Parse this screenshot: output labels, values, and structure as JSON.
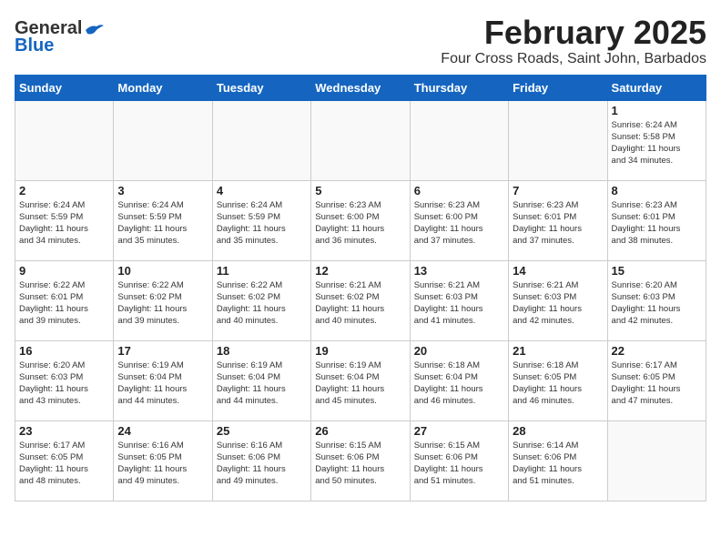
{
  "logo": {
    "general": "General",
    "blue": "Blue"
  },
  "title": "February 2025",
  "subtitle": "Four Cross Roads, Saint John, Barbados",
  "weekdays": [
    "Sunday",
    "Monday",
    "Tuesday",
    "Wednesday",
    "Thursday",
    "Friday",
    "Saturday"
  ],
  "weeks": [
    [
      {
        "day": "",
        "info": ""
      },
      {
        "day": "",
        "info": ""
      },
      {
        "day": "",
        "info": ""
      },
      {
        "day": "",
        "info": ""
      },
      {
        "day": "",
        "info": ""
      },
      {
        "day": "",
        "info": ""
      },
      {
        "day": "1",
        "info": "Sunrise: 6:24 AM\nSunset: 5:58 PM\nDaylight: 11 hours\nand 34 minutes."
      }
    ],
    [
      {
        "day": "2",
        "info": "Sunrise: 6:24 AM\nSunset: 5:59 PM\nDaylight: 11 hours\nand 34 minutes."
      },
      {
        "day": "3",
        "info": "Sunrise: 6:24 AM\nSunset: 5:59 PM\nDaylight: 11 hours\nand 35 minutes."
      },
      {
        "day": "4",
        "info": "Sunrise: 6:24 AM\nSunset: 5:59 PM\nDaylight: 11 hours\nand 35 minutes."
      },
      {
        "day": "5",
        "info": "Sunrise: 6:23 AM\nSunset: 6:00 PM\nDaylight: 11 hours\nand 36 minutes."
      },
      {
        "day": "6",
        "info": "Sunrise: 6:23 AM\nSunset: 6:00 PM\nDaylight: 11 hours\nand 37 minutes."
      },
      {
        "day": "7",
        "info": "Sunrise: 6:23 AM\nSunset: 6:01 PM\nDaylight: 11 hours\nand 37 minutes."
      },
      {
        "day": "8",
        "info": "Sunrise: 6:23 AM\nSunset: 6:01 PM\nDaylight: 11 hours\nand 38 minutes."
      }
    ],
    [
      {
        "day": "9",
        "info": "Sunrise: 6:22 AM\nSunset: 6:01 PM\nDaylight: 11 hours\nand 39 minutes."
      },
      {
        "day": "10",
        "info": "Sunrise: 6:22 AM\nSunset: 6:02 PM\nDaylight: 11 hours\nand 39 minutes."
      },
      {
        "day": "11",
        "info": "Sunrise: 6:22 AM\nSunset: 6:02 PM\nDaylight: 11 hours\nand 40 minutes."
      },
      {
        "day": "12",
        "info": "Sunrise: 6:21 AM\nSunset: 6:02 PM\nDaylight: 11 hours\nand 40 minutes."
      },
      {
        "day": "13",
        "info": "Sunrise: 6:21 AM\nSunset: 6:03 PM\nDaylight: 11 hours\nand 41 minutes."
      },
      {
        "day": "14",
        "info": "Sunrise: 6:21 AM\nSunset: 6:03 PM\nDaylight: 11 hours\nand 42 minutes."
      },
      {
        "day": "15",
        "info": "Sunrise: 6:20 AM\nSunset: 6:03 PM\nDaylight: 11 hours\nand 42 minutes."
      }
    ],
    [
      {
        "day": "16",
        "info": "Sunrise: 6:20 AM\nSunset: 6:03 PM\nDaylight: 11 hours\nand 43 minutes."
      },
      {
        "day": "17",
        "info": "Sunrise: 6:19 AM\nSunset: 6:04 PM\nDaylight: 11 hours\nand 44 minutes."
      },
      {
        "day": "18",
        "info": "Sunrise: 6:19 AM\nSunset: 6:04 PM\nDaylight: 11 hours\nand 44 minutes."
      },
      {
        "day": "19",
        "info": "Sunrise: 6:19 AM\nSunset: 6:04 PM\nDaylight: 11 hours\nand 45 minutes."
      },
      {
        "day": "20",
        "info": "Sunrise: 6:18 AM\nSunset: 6:04 PM\nDaylight: 11 hours\nand 46 minutes."
      },
      {
        "day": "21",
        "info": "Sunrise: 6:18 AM\nSunset: 6:05 PM\nDaylight: 11 hours\nand 46 minutes."
      },
      {
        "day": "22",
        "info": "Sunrise: 6:17 AM\nSunset: 6:05 PM\nDaylight: 11 hours\nand 47 minutes."
      }
    ],
    [
      {
        "day": "23",
        "info": "Sunrise: 6:17 AM\nSunset: 6:05 PM\nDaylight: 11 hours\nand 48 minutes."
      },
      {
        "day": "24",
        "info": "Sunrise: 6:16 AM\nSunset: 6:05 PM\nDaylight: 11 hours\nand 49 minutes."
      },
      {
        "day": "25",
        "info": "Sunrise: 6:16 AM\nSunset: 6:06 PM\nDaylight: 11 hours\nand 49 minutes."
      },
      {
        "day": "26",
        "info": "Sunrise: 6:15 AM\nSunset: 6:06 PM\nDaylight: 11 hours\nand 50 minutes."
      },
      {
        "day": "27",
        "info": "Sunrise: 6:15 AM\nSunset: 6:06 PM\nDaylight: 11 hours\nand 51 minutes."
      },
      {
        "day": "28",
        "info": "Sunrise: 6:14 AM\nSunset: 6:06 PM\nDaylight: 11 hours\nand 51 minutes."
      },
      {
        "day": "",
        "info": ""
      }
    ]
  ]
}
